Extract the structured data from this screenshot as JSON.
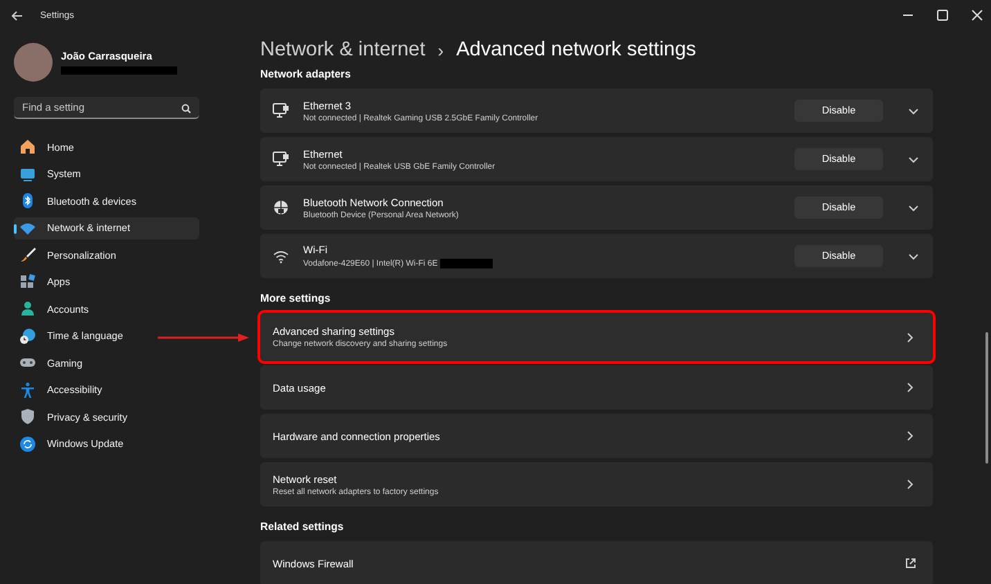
{
  "window": {
    "title": "Settings"
  },
  "user": {
    "name": "João Carrasqueira"
  },
  "search": {
    "placeholder": "Find a setting"
  },
  "nav": [
    {
      "label": "Home",
      "selected": false
    },
    {
      "label": "System",
      "selected": false
    },
    {
      "label": "Bluetooth & devices",
      "selected": false
    },
    {
      "label": "Network & internet",
      "selected": true
    },
    {
      "label": "Personalization",
      "selected": false
    },
    {
      "label": "Apps",
      "selected": false
    },
    {
      "label": "Accounts",
      "selected": false
    },
    {
      "label": "Time & language",
      "selected": false
    },
    {
      "label": "Gaming",
      "selected": false
    },
    {
      "label": "Accessibility",
      "selected": false
    },
    {
      "label": "Privacy & security",
      "selected": false
    },
    {
      "label": "Windows Update",
      "selected": false
    }
  ],
  "breadcrumb": {
    "parent": "Network & internet",
    "separator": "›",
    "current": "Advanced network settings"
  },
  "sections": [
    {
      "heading": "Network adapters",
      "rows": [
        {
          "kind": "adapter",
          "title": "Ethernet 3",
          "subtitle": "Not connected | Realtek Gaming USB 2.5GbE Family Controller",
          "button": "Disable",
          "redacted": false
        },
        {
          "kind": "adapter",
          "title": "Ethernet",
          "subtitle": "Not connected | Realtek USB GbE Family Controller",
          "button": "Disable",
          "redacted": false
        },
        {
          "kind": "adapter",
          "title": "Bluetooth Network Connection",
          "subtitle": "Bluetooth Device (Personal Area Network)",
          "button": "Disable",
          "redacted": false
        },
        {
          "kind": "adapter",
          "title": "Wi-Fi",
          "subtitle": "Vodafone-429E60 | Intel(R) Wi-Fi 6E",
          "button": "Disable",
          "redacted": true
        }
      ]
    },
    {
      "heading": "More settings",
      "rows": [
        {
          "kind": "link",
          "title": "Advanced sharing settings",
          "subtitle": "Change network discovery and sharing settings",
          "highlighted": true
        },
        {
          "kind": "link",
          "title": "Data usage",
          "highlighted": false
        },
        {
          "kind": "link",
          "title": "Hardware and connection properties",
          "highlighted": false
        },
        {
          "kind": "link",
          "title": "Network reset",
          "subtitle": "Reset all network adapters to factory settings",
          "highlighted": false
        }
      ]
    },
    {
      "heading": "Related settings",
      "rows": [
        {
          "kind": "external",
          "title": "Windows Firewall",
          "highlighted": false
        }
      ]
    }
  ]
}
